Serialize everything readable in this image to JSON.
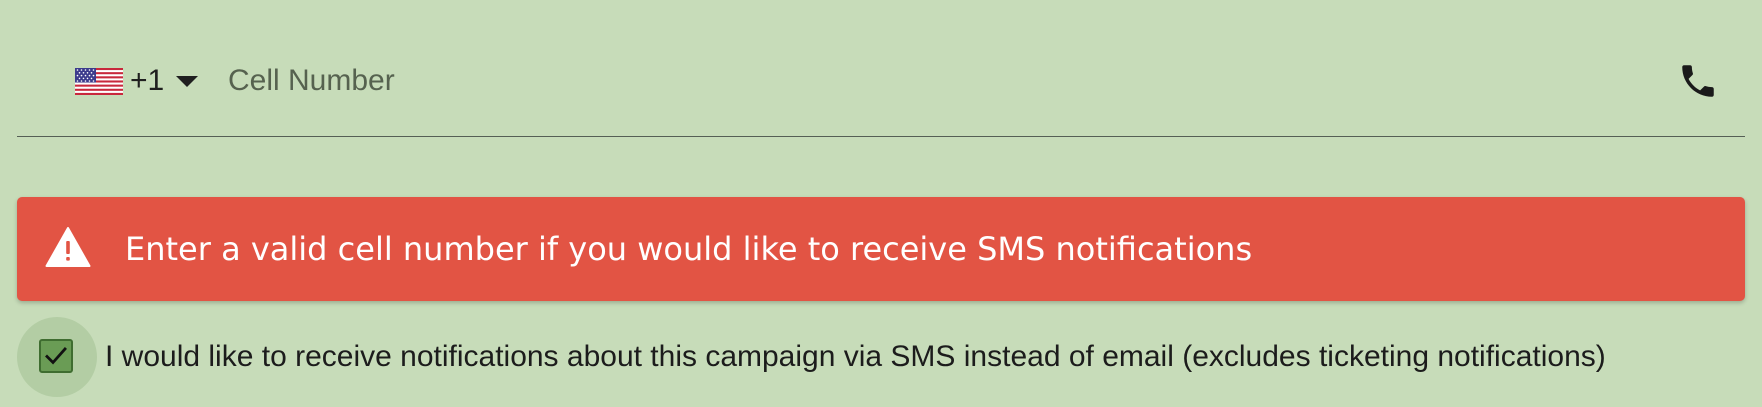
{
  "phone": {
    "country_code": "+1",
    "country_flag": "us-flag-icon",
    "placeholder": "Cell Number",
    "value": "",
    "trailing_icon": "phone-icon"
  },
  "alert": {
    "icon": "warning-triangle-icon",
    "message": "Enter a valid cell number if you would like to receive SMS notifications",
    "color": "#e25444"
  },
  "sms_option": {
    "checked": true,
    "label": "I would like to receive notifications about this campaign via SMS instead of email (excludes ticketing notifications)"
  },
  "colors": {
    "background": "#c7dcb9",
    "checkbox_fill": "#6a9c55"
  }
}
